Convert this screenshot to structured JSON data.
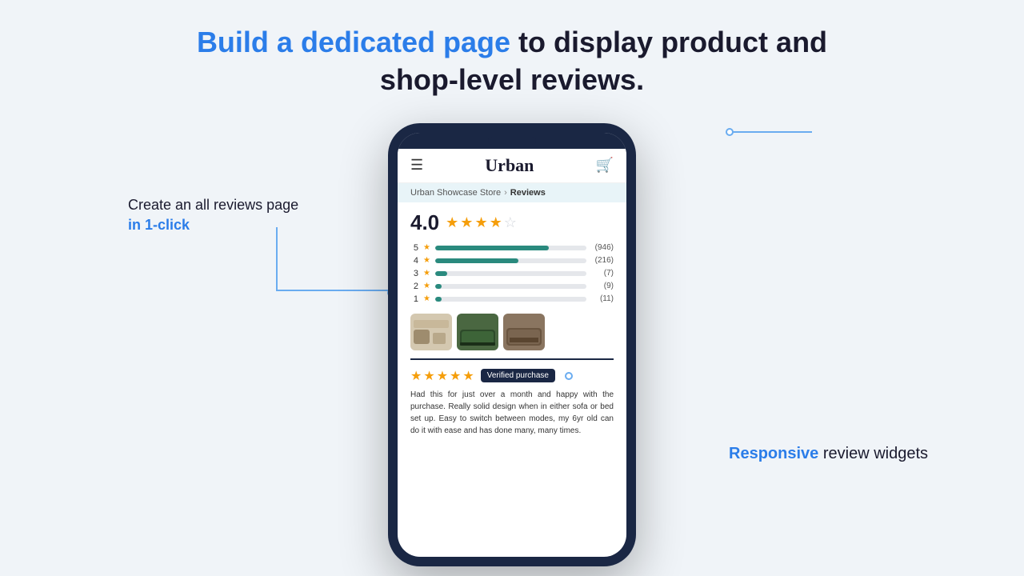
{
  "headline": {
    "part1": "Build a dedicated page",
    "part2": " to display product and",
    "part3": "shop-level reviews."
  },
  "left_annotation": {
    "line1": "Create an all reviews page",
    "line2": "in 1-click"
  },
  "right_annotation": {
    "part1": "Responsive",
    "part2": " review widgets"
  },
  "app": {
    "title": "Urban",
    "breadcrumb_store": "Urban Showcase Store",
    "breadcrumb_page": "Reviews",
    "overall_rating": "4.0",
    "bars": [
      {
        "label": "5",
        "width": "75%",
        "count": "(946)"
      },
      {
        "label": "4",
        "width": "55%",
        "count": "(216)"
      },
      {
        "label": "3",
        "width": "8%",
        "count": "(7)"
      },
      {
        "label": "2",
        "width": "4%",
        "count": "(9)"
      },
      {
        "label": "1",
        "width": "4%",
        "count": "(11)"
      }
    ],
    "verified_label": "Verified purchase",
    "review_text": "Had this for just over a month and happy with the purchase. Really solid design when in either sofa or bed set up. Easy to switch between modes, my 6yr old can do it with ease and has done many, many times."
  }
}
